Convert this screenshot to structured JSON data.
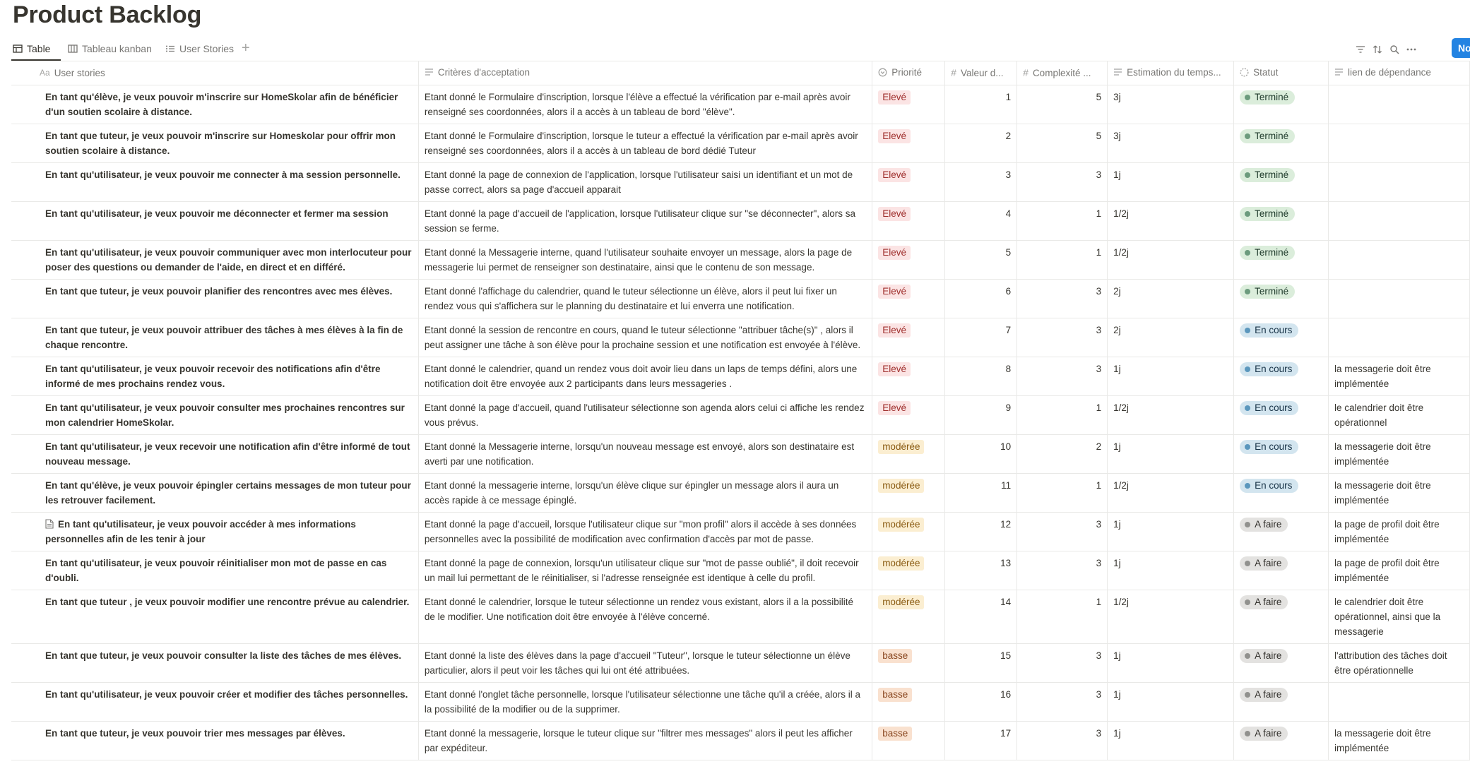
{
  "page": {
    "title": "Product Backlog"
  },
  "views": [
    {
      "label": "Table",
      "icon": "table-icon"
    },
    {
      "label": "Tableau kanban",
      "icon": "board-icon"
    },
    {
      "label": "User Stories",
      "icon": "list-icon"
    }
  ],
  "toolbar": {
    "new_label": "Nouv"
  },
  "columns": {
    "story": "User stories",
    "criteria": "Critères d'acceptation",
    "priority": "Priorité",
    "value": "Valeur d...",
    "complexity": "Complexité ...",
    "estimate": "Estimation du temps...",
    "status": "Statut",
    "dependency": "lien de dépendance"
  },
  "colors": {
    "accent": "#2383e2",
    "priority_high": "#fbe4e4",
    "priority_moderate": "#fbeed1",
    "priority_low": "#f9e1cf"
  },
  "rows": [
    {
      "story": "En tant qu'élève, je veux pouvoir m'inscrire sur HomeSkolar afin de bénéficier d'un soutien scolaire à distance.",
      "criteria": "Etant donné le Formulaire d'inscription, lorsque l'élève a effectué la vérification par e-mail après avoir renseigné ses coordonnées, alors il a accès à un tableau de bord \"élève\".",
      "priority": "Elevé",
      "value": "1",
      "complexity": "5",
      "estimate": "3j",
      "status": "Terminé",
      "dependency": ""
    },
    {
      "story": "En tant que tuteur, je veux pouvoir m'inscrire sur Homeskolar pour offrir mon soutien scolaire à distance.",
      "criteria": "Etant donné le Formulaire d'inscription, lorsque le tuteur a effectué la vérification par e-mail après avoir renseigné ses coordonnées, alors il a accès à un tableau de bord dédié Tuteur",
      "priority": "Elevé",
      "value": "2",
      "complexity": "5",
      "estimate": "3j",
      "status": "Terminé",
      "dependency": ""
    },
    {
      "story": "En tant qu'utilisateur, je veux pouvoir me connecter à ma session personnelle.",
      "criteria": "Etant donné la page de connexion de l'application, lorsque l'utilisateur saisi un identifiant et un mot de passe correct, alors sa page d'accueil apparait",
      "priority": "Elevé",
      "value": "3",
      "complexity": "3",
      "estimate": "1j",
      "status": "Terminé",
      "dependency": ""
    },
    {
      "story": "En tant qu'utilisateur, je veux pouvoir me déconnecter et fermer ma session",
      "criteria": "Etant donné la page d'accueil de l'application, lorsque l'utilisateur clique sur \"se déconnecter\", alors sa session se ferme.",
      "priority": "Elevé",
      "value": "4",
      "complexity": "1",
      "estimate": "1/2j",
      "status": "Terminé",
      "dependency": ""
    },
    {
      "story": "En tant qu'utilisateur,  je veux pouvoir communiquer avec mon interlocuteur pour poser des questions ou demander de l'aide, en direct et en différé.",
      "criteria": "Etant donné la Messagerie interne, quand l'utilisateur souhaite envoyer un message, alors la page de messagerie lui permet de renseigner son destinataire, ainsi que le contenu de son message.",
      "priority": "Elevé",
      "value": "5",
      "complexity": "1",
      "estimate": "1/2j",
      "status": "Terminé",
      "dependency": ""
    },
    {
      "story": "En tant que tuteur, je veux pouvoir planifier des rencontres avec mes élèves.",
      "criteria": "Etant donné l'affichage du calendrier, quand le tuteur sélectionne un élève, alors il peut lui fixer un rendez vous qui s'affichera sur le planning du destinataire et lui enverra une notification.",
      "priority": "Elevé",
      "value": "6",
      "complexity": "3",
      "estimate": "2j",
      "status": "Terminé",
      "dependency": ""
    },
    {
      "story": "En tant que tuteur, je veux pouvoir attribuer des tâches à mes élèves à la fin de chaque rencontre.",
      "criteria": "Etant donné la session de rencontre en cours, quand le tuteur sélectionne \"attribuer tâche(s)\" , alors il peut assigner une tâche à son élève pour la prochaine session et une notification est envoyée à l'élève.",
      "priority": "Elevé",
      "value": "7",
      "complexity": "3",
      "estimate": "2j",
      "status": "En cours",
      "dependency": ""
    },
    {
      "story": "En tant qu'utilisateur, je veux pouvoir recevoir des notifications afin d'être informé de mes prochains rendez vous.",
      "criteria": "Etant donné le calendrier, quand un rendez vous doit avoir lieu dans un laps de temps défini, alors une notification doit être envoyée aux 2 participants dans leurs messageries .",
      "priority": "Elevé",
      "value": "8",
      "complexity": "3",
      "estimate": "1j",
      "status": "En cours",
      "dependency": "la messagerie doit être implémentée"
    },
    {
      "story": "En tant qu'utilisateur, je veux pouvoir consulter mes prochaines rencontres sur mon calendrier HomeSkolar.",
      "criteria": "Etant donné la page d'accueil, quand l'utilisateur sélectionne  son agenda alors celui ci affiche les rendez vous prévus.",
      "priority": "Elevé",
      "value": "9",
      "complexity": "1",
      "estimate": "1/2j",
      "status": "En cours",
      "dependency": "le calendrier doit être opérationnel"
    },
    {
      "story": "En tant qu'utilisateur, je veux recevoir une notification afin d'être informé de tout nouveau message.",
      "criteria": "Etant donné la Messagerie interne, lorsqu'un nouveau message est envoyé, alors son destinataire est averti par une notification.",
      "priority": "modérée",
      "value": "10",
      "complexity": "2",
      "estimate": "1j",
      "status": "En cours",
      "dependency": "la messagerie doit être implémentée"
    },
    {
      "story": "En tant qu'élève, je veux pouvoir épingler certains messages de mon tuteur pour les retrouver facilement.",
      "criteria": "Etant donné la messagerie interne, lorsqu'un élève clique sur épingler un message alors il aura un accès rapide à ce message épinglé.",
      "priority": "modérée",
      "value": "11",
      "complexity": "1",
      "estimate": "1/2j",
      "status": "En cours",
      "dependency": "la messagerie doit être implémentée"
    },
    {
      "story": "En tant qu'utilisateur, je veux pouvoir accéder à mes informations personnelles afin de les tenir à jour",
      "criteria": "Etant donné la page d'accueil, lorsque l'utilisateur clique sur \"mon profil\" alors il accède à ses données personnelles avec la possibilité de modification avec confirmation d'accès par mot de passe.",
      "priority": "modérée",
      "value": "12",
      "complexity": "3",
      "estimate": "1j",
      "status": "A faire",
      "dependency": "la page de profil doit être implémentée",
      "has_doc": true
    },
    {
      "story": "En tant qu'utilisateur, je veux pouvoir réinitialiser mon mot de passe en cas d'oubli.",
      "criteria": "Etant donné la page de connexion, lorsqu'un utilisateur clique sur \"mot de passe oublié\", il doit recevoir un mail lui permettant de le réinitialiser, si l'adresse renseignée est identique à celle du profil.",
      "priority": "modérée",
      "value": "13",
      "complexity": "3",
      "estimate": "1j",
      "status": "A faire",
      "dependency": "la page de profil doit être implémentée"
    },
    {
      "story": "En tant que tuteur , je veux pouvoir modifier une rencontre prévue au calendrier.",
      "criteria": "Etant donné le calendrier, lorsque le tuteur sélectionne un rendez vous existant, alors il a la possibilité de le modifier. Une notification doit être envoyée à l'élève concerné.",
      "priority": "modérée",
      "value": "14",
      "complexity": "1",
      "estimate": "1/2j",
      "status": "A faire",
      "dependency": "le calendrier doit être opérationnel, ainsi que la messagerie"
    },
    {
      "story": "En tant que tuteur, je veux pouvoir consulter la liste des tâches de mes élèves.",
      "criteria": "Etant donné la liste des élèves dans la page d'accueil \"Tuteur\", lorsque le tuteur sélectionne un élève particulier, alors il peut voir les tâches qui lui ont été attribuées.",
      "priority": "basse",
      "value": "15",
      "complexity": "3",
      "estimate": "1j",
      "status": "A faire",
      "dependency": "l'attribution des tâches doit être opérationnelle"
    },
    {
      "story": "En tant qu'utilisateur, je veux pouvoir créer et modifier des tâches personnelles.",
      "criteria": "Etant donné l'onglet tâche personnelle, lorsque l'utilisateur sélectionne une tâche qu'il a créée, alors il a la possibilité de la modifier ou de la supprimer.",
      "priority": "basse",
      "value": "16",
      "complexity": "3",
      "estimate": "1j",
      "status": "A faire",
      "dependency": ""
    },
    {
      "story": "En tant que tuteur, je veux pouvoir trier mes messages par élèves.",
      "criteria": "Etant donné la messagerie, lorsque le tuteur clique sur \"filtrer mes messages\" alors il peut les afficher par expéditeur.",
      "priority": "basse",
      "value": "17",
      "complexity": "3",
      "estimate": "1j",
      "status": "A faire",
      "dependency": "la messagerie doit être implémentée"
    }
  ]
}
